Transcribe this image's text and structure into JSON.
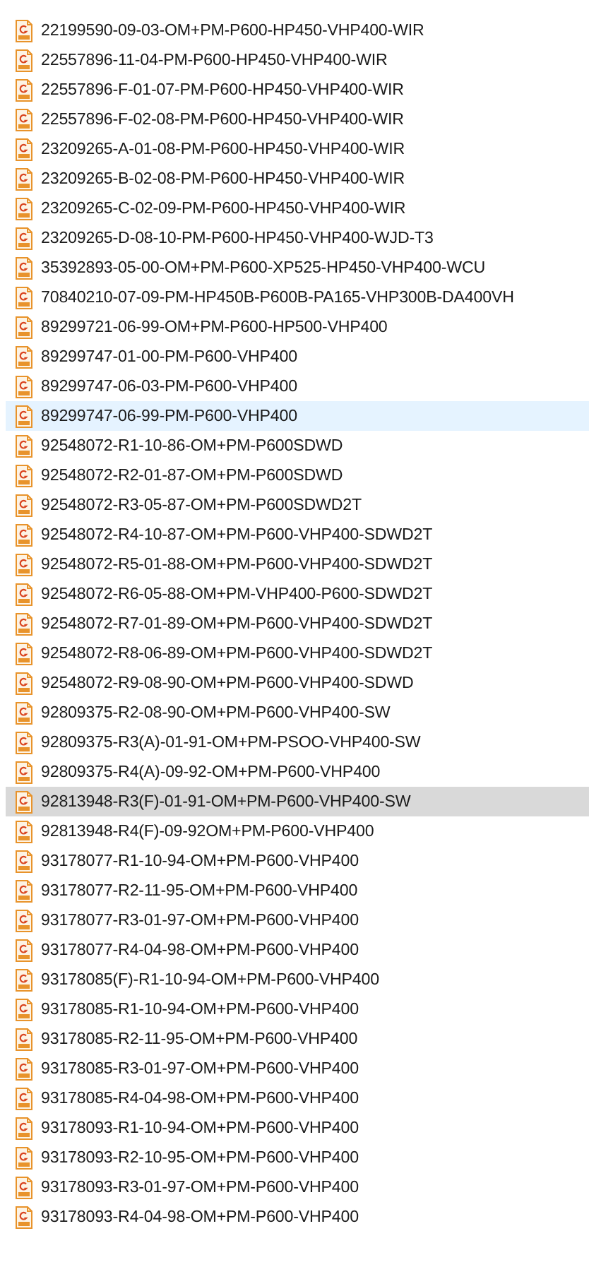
{
  "files": [
    {
      "name": "22199590-09-03-OM+PM-P600-HP450-VHP400-WIR",
      "selected": false,
      "hovered": false
    },
    {
      "name": "22557896-11-04-PM-P600-HP450-VHP400-WIR",
      "selected": false,
      "hovered": false
    },
    {
      "name": "22557896-F-01-07-PM-P600-HP450-VHP400-WIR",
      "selected": false,
      "hovered": false
    },
    {
      "name": "22557896-F-02-08-PM-P600-HP450-VHP400-WIR",
      "selected": false,
      "hovered": false
    },
    {
      "name": "23209265-A-01-08-PM-P600-HP450-VHP400-WIR",
      "selected": false,
      "hovered": false
    },
    {
      "name": "23209265-B-02-08-PM-P600-HP450-VHP400-WIR",
      "selected": false,
      "hovered": false
    },
    {
      "name": "23209265-C-02-09-PM-P600-HP450-VHP400-WIR",
      "selected": false,
      "hovered": false
    },
    {
      "name": "23209265-D-08-10-PM-P600-HP450-VHP400-WJD-T3",
      "selected": false,
      "hovered": false
    },
    {
      "name": "35392893-05-00-OM+PM-P600-XP525-HP450-VHP400-WCU",
      "selected": false,
      "hovered": false
    },
    {
      "name": "70840210-07-09-PM-HP450B-P600B-PA165-VHP300B-DA400VH",
      "selected": false,
      "hovered": false
    },
    {
      "name": "89299721-06-99-OM+PM-P600-HP500-VHP400",
      "selected": false,
      "hovered": false
    },
    {
      "name": "89299747-01-00-PM-P600-VHP400",
      "selected": false,
      "hovered": false
    },
    {
      "name": "89299747-06-03-PM-P600-VHP400",
      "selected": false,
      "hovered": false
    },
    {
      "name": "89299747-06-99-PM-P600-VHP400",
      "selected": false,
      "hovered": true
    },
    {
      "name": "92548072-R1-10-86-OM+PM-P600SDWD",
      "selected": false,
      "hovered": false
    },
    {
      "name": "92548072-R2-01-87-OM+PM-P600SDWD",
      "selected": false,
      "hovered": false
    },
    {
      "name": "92548072-R3-05-87-OM+PM-P600SDWD2T",
      "selected": false,
      "hovered": false
    },
    {
      "name": "92548072-R4-10-87-OM+PM-P600-VHP400-SDWD2T",
      "selected": false,
      "hovered": false
    },
    {
      "name": "92548072-R5-01-88-OM+PM-P600-VHP400-SDWD2T",
      "selected": false,
      "hovered": false
    },
    {
      "name": "92548072-R6-05-88-OM+PM-VHP400-P600-SDWD2T",
      "selected": false,
      "hovered": false
    },
    {
      "name": "92548072-R7-01-89-OM+PM-P600-VHP400-SDWD2T",
      "selected": false,
      "hovered": false
    },
    {
      "name": "92548072-R8-06-89-OM+PM-P600-VHP400-SDWD2T",
      "selected": false,
      "hovered": false
    },
    {
      "name": "92548072-R9-08-90-OM+PM-P600-VHP400-SDWD",
      "selected": false,
      "hovered": false
    },
    {
      "name": "92809375-R2-08-90-OM+PM-P600-VHP400-SW",
      "selected": false,
      "hovered": false
    },
    {
      "name": "92809375-R3(A)-01-91-OM+PM-PSOO-VHP400-SW",
      "selected": false,
      "hovered": false
    },
    {
      "name": "92809375-R4(A)-09-92-OM+PM-P600-VHP400",
      "selected": false,
      "hovered": false
    },
    {
      "name": "92813948-R3(F)-01-91-OM+PM-P600-VHP400-SW",
      "selected": true,
      "hovered": false
    },
    {
      "name": "92813948-R4(F)-09-92OM+PM-P600-VHP400",
      "selected": false,
      "hovered": false
    },
    {
      "name": "93178077-R1-10-94-OM+PM-P600-VHP400",
      "selected": false,
      "hovered": false
    },
    {
      "name": "93178077-R2-11-95-OM+PM-P600-VHP400",
      "selected": false,
      "hovered": false
    },
    {
      "name": "93178077-R3-01-97-OM+PM-P600-VHP400",
      "selected": false,
      "hovered": false
    },
    {
      "name": "93178077-R4-04-98-OM+PM-P600-VHP400",
      "selected": false,
      "hovered": false
    },
    {
      "name": "93178085(F)-R1-10-94-OM+PM-P600-VHP400",
      "selected": false,
      "hovered": false
    },
    {
      "name": "93178085-R1-10-94-OM+PM-P600-VHP400",
      "selected": false,
      "hovered": false
    },
    {
      "name": "93178085-R2-11-95-OM+PM-P600-VHP400",
      "selected": false,
      "hovered": false
    },
    {
      "name": "93178085-R3-01-97-OM+PM-P600-VHP400",
      "selected": false,
      "hovered": false
    },
    {
      "name": "93178085-R4-04-98-OM+PM-P600-VHP400",
      "selected": false,
      "hovered": false
    },
    {
      "name": "93178093-R1-10-94-OM+PM-P600-VHP400",
      "selected": false,
      "hovered": false
    },
    {
      "name": "93178093-R2-10-95-OM+PM-P600-VHP400",
      "selected": false,
      "hovered": false
    },
    {
      "name": "93178093-R3-01-97-OM+PM-P600-VHP400",
      "selected": false,
      "hovered": false
    },
    {
      "name": "93178093-R4-04-98-OM+PM-P600-VHP400",
      "selected": false,
      "hovered": false
    }
  ]
}
